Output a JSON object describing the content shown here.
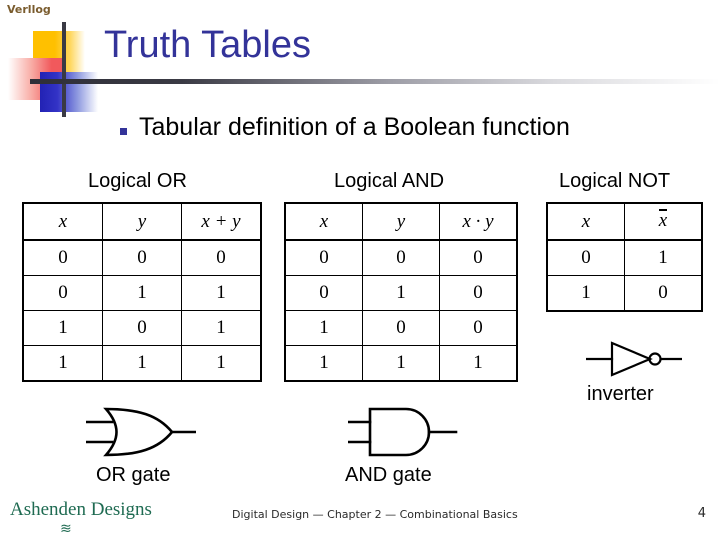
{
  "slide": {
    "brand_mark": "Verllog",
    "title": "Truth Tables",
    "bullet": "Tabular definition of a Boolean function"
  },
  "tables": {
    "or": {
      "caption": "Logical OR",
      "headers": [
        "x",
        "y",
        "x + y"
      ],
      "rows": [
        [
          "0",
          "0",
          "0"
        ],
        [
          "0",
          "1",
          "1"
        ],
        [
          "1",
          "0",
          "1"
        ],
        [
          "1",
          "1",
          "1"
        ]
      ]
    },
    "and": {
      "caption": "Logical AND",
      "headers": [
        "x",
        "y",
        "x · y"
      ],
      "rows": [
        [
          "0",
          "0",
          "0"
        ],
        [
          "0",
          "1",
          "0"
        ],
        [
          "1",
          "0",
          "0"
        ],
        [
          "1",
          "1",
          "1"
        ]
      ]
    },
    "not": {
      "caption": "Logical NOT",
      "headers": [
        "x",
        "x"
      ],
      "header_overbar": "x",
      "rows": [
        [
          "0",
          "1"
        ],
        [
          "1",
          "0"
        ]
      ]
    }
  },
  "gates": {
    "or_label": "OR gate",
    "and_label": "AND gate",
    "not_label": "inverter",
    "or_icon": "or-gate-symbol",
    "and_icon": "and-gate-symbol",
    "not_icon": "inverter-symbol"
  },
  "footer": {
    "logo": "Ashenden Designs",
    "logo_swash": "≋",
    "text": "Digital Design — Chapter 2 — Combinational Basics",
    "page_number": "4"
  },
  "colors": {
    "title_blue": "#333399",
    "bullet_blue": "#333399",
    "brand_brown": "#7A5C2E",
    "logo_green": "#1F6B52",
    "deco_yellow": "#FFC000",
    "deco_red": "#F1595C",
    "deco_blue": "#2222B4"
  }
}
